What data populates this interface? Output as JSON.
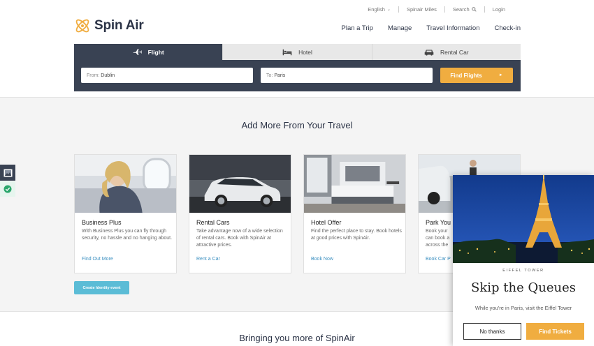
{
  "brand": {
    "name": "Spin Air"
  },
  "utility_nav": {
    "language": "English",
    "miles": "Spinair Miles",
    "search": "Search",
    "login": "Login"
  },
  "main_nav": [
    "Plan a Trip",
    "Manage",
    "Travel Information",
    "Check-in"
  ],
  "booking": {
    "tabs": [
      {
        "label": "Flight",
        "icon": "airplane-icon",
        "active": true
      },
      {
        "label": "Hotel",
        "icon": "bed-icon",
        "active": false
      },
      {
        "label": "Rental Car",
        "icon": "car-icon",
        "active": false
      }
    ],
    "from_label": "From:",
    "from_value": "Dublin",
    "to_label": "To:",
    "to_value": "Paris",
    "find_button": "Find Flights"
  },
  "section_title": "Add More From Your Travel",
  "cards": [
    {
      "title": "Business Plus",
      "description": "With Business Plus you can fly through security, no hassle and no hanging about.",
      "link": "Find Out More"
    },
    {
      "title": "Rental Cars",
      "description": "Take advantage now of a wide selection of rental cars. Book with SpinAir at attractive prices.",
      "link": "Rent a Car"
    },
    {
      "title": "Hotel Offer",
      "description": "Find the perfect place to stay. Book hotels at good prices with SpinAir.",
      "link": "Book Now"
    },
    {
      "title": "Park You",
      "description": "Book your\ncan book a\nacross the",
      "link": "Book Car P"
    }
  ],
  "identity_button": "Create Identity event",
  "bottom_title": "Bringing you more of SpinAir",
  "popup": {
    "eyebrow": "EIFFEL TOWER",
    "title": "Skip the Queues",
    "subtitle": "While you're in Paris, visit the Eiffel Tower",
    "no_button": "No thanks",
    "yes_button": "Find Tickets"
  },
  "colors": {
    "navy": "#394253",
    "accent": "#f0ad40",
    "link": "#3a8fc0",
    "identity": "#5bbcd6"
  }
}
